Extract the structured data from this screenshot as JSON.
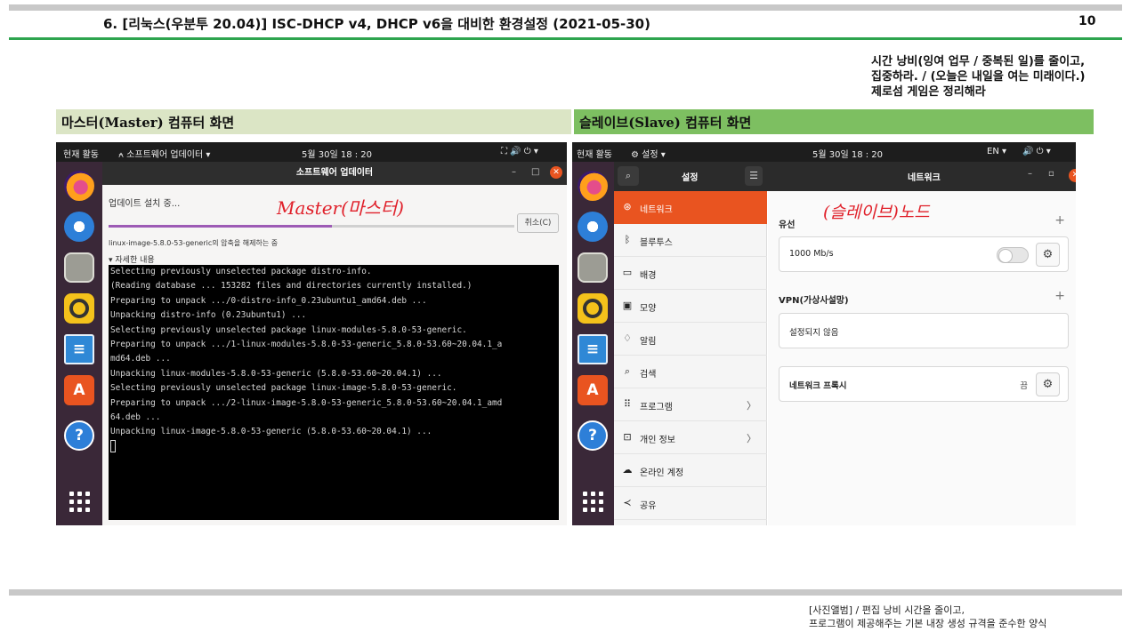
{
  "header": {
    "title": "6. [리눅스(우분투 20.04)] ISC-DHCP v4, DHCP v6을 대비한 환경설정 (2021-05-30)",
    "page_number": "10",
    "motto_lines": [
      "시간 낭비(잉여 업무 / 중복된 일)를 줄이고,",
      "집중하라. / (오늘은 내일을 여는 미래이다.)",
      "제로섬 게임은 정리해라"
    ]
  },
  "sections": {
    "master_label": "마스터(Master) 컴퓨터 화면",
    "slave_label": "슬레이브(Slave) 컴퓨터 화면"
  },
  "master": {
    "topbar": {
      "activities": "현재 활동",
      "app_menu": "⍲ 소프트웨어 업데이터 ▾",
      "clock": "5월 30일 18 : 20",
      "status_icons": "⛶ 🔊 ⏻ ▾"
    },
    "window_title": "소프트웨어 업데이터",
    "status_text": "업데이트 설치 중...",
    "progress": 0.55,
    "cancel_label": "취소(C)",
    "package_text": "linux-image-5.8.0-53-generic의 압축을 해제하는 중",
    "details_label": "▾ 자세한 내용",
    "terminal_lines": [
      "Selecting previously unselected package distro-info.",
      "(Reading database ... 153282 files and directories currently installed.)",
      "Preparing to unpack .../0-distro-info_0.23ubuntu1_amd64.deb ...",
      "Unpacking distro-info (0.23ubuntu1) ...",
      "Selecting previously unselected package linux-modules-5.8.0-53-generic.",
      "Preparing to unpack .../1-linux-modules-5.8.0-53-generic_5.8.0-53.60~20.04.1_a",
      "md64.deb ...",
      "Unpacking linux-modules-5.8.0-53-generic (5.8.0-53.60~20.04.1) ...",
      "Selecting previously unselected package linux-image-5.8.0-53-generic.",
      "Preparing to unpack .../2-linux-image-5.8.0-53-generic_5.8.0-53.60~20.04.1_amd",
      "64.deb ...",
      "Unpacking linux-image-5.8.0-53-generic (5.8.0-53.60~20.04.1) ..."
    ],
    "handwritten_note": "Master(마스터)"
  },
  "slave": {
    "topbar": {
      "activities": "현재 활동",
      "app_menu": "⚙ 설정 ▾",
      "clock": "5월 30일 18 : 20",
      "lang": "EN ▾",
      "status_icons": "🔊 ⏻ ▾"
    },
    "sidebar_title": "설정",
    "panel_title": "네트워크",
    "sidebar_items": [
      {
        "label": "네트워크",
        "icon": "network-icon"
      },
      {
        "label": "블루투스",
        "icon": "bluetooth-icon"
      },
      {
        "label": "배경",
        "icon": "background-icon"
      },
      {
        "label": "모양",
        "icon": "appearance-icon"
      },
      {
        "label": "알림",
        "icon": "bell-icon"
      },
      {
        "label": "검색",
        "icon": "search-icon"
      },
      {
        "label": "프로그램",
        "icon": "apps-icon"
      },
      {
        "label": "개인 정보",
        "icon": "lock-icon"
      },
      {
        "label": "온라인 계정",
        "icon": "cloud-icon"
      },
      {
        "label": "공유",
        "icon": "share-icon"
      }
    ],
    "wired": {
      "label": "유선",
      "speed": "1000 Mb/s",
      "enabled": false
    },
    "vpn": {
      "label": "VPN(가상사설망)",
      "status": "설정되지 않음"
    },
    "proxy": {
      "label": "네트워크 프록시",
      "state": "끔"
    },
    "handwritten_note": "(슬레이브)노드"
  },
  "footer": {
    "line1": "[사진앨범] / 편집 낭비 시간을 줄이고,",
    "line2": "프로그램이 제공해주는 기본 내장 생성 규격을 준수한 양식"
  },
  "colors": {
    "accent": "#e95420",
    "green_line": "#2da44e",
    "master_header_bg": "#dbe5c5",
    "slave_header_bg": "#7dbf61"
  }
}
